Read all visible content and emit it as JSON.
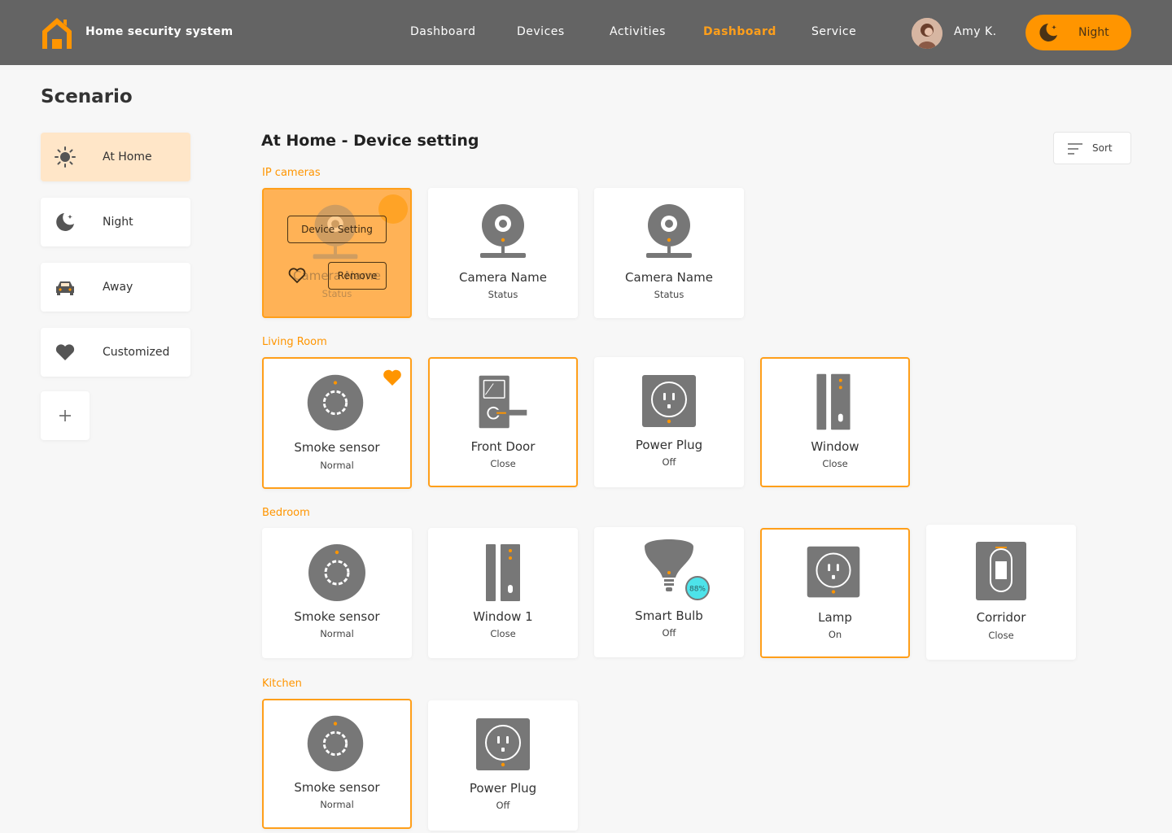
{
  "header": {
    "app_title": "Home security system",
    "nav": [
      {
        "label": "Dashboard"
      },
      {
        "label": "Devices"
      },
      {
        "label": "Activities"
      },
      {
        "label": "Dashboard",
        "active": true
      },
      {
        "label": "Service"
      }
    ],
    "user_name": "Amy K.",
    "mode_button": "Night"
  },
  "sidebar": {
    "title": "Scenario",
    "items": [
      {
        "label": "At Home",
        "icon": "sun-icon",
        "active": true
      },
      {
        "label": "Night",
        "icon": "moon-icon"
      },
      {
        "label": "Away",
        "icon": "car-icon"
      },
      {
        "label": "Customized",
        "icon": "heart-icon"
      }
    ],
    "add_icon": "plus-icon"
  },
  "main": {
    "title": "At Home - Device setting",
    "sort_label": "Sort",
    "overlay": {
      "device_setting": "Device Setting",
      "remove": "Remove",
      "ghost_name": "Camera Name",
      "ghost_status": "Status"
    },
    "sections": [
      {
        "label": "IP cameras",
        "devices": [
          {
            "name": "Camera Name",
            "status": "Status",
            "icon": "camera-icon"
          },
          {
            "name": "Camera Name",
            "status": "Status",
            "icon": "camera-icon"
          }
        ]
      },
      {
        "label": "Living Room",
        "devices": [
          {
            "name": "Smoke sensor",
            "status": "Normal",
            "icon": "smoke-sensor-icon",
            "favorite": true
          },
          {
            "name": "Front Door",
            "status": "Close",
            "icon": "door-lock-icon"
          },
          {
            "name": "Power Plug",
            "status": "Off",
            "icon": "power-plug-icon"
          },
          {
            "name": "Window",
            "status": "Close",
            "icon": "window-sensor-icon"
          }
        ]
      },
      {
        "label": "Bedroom",
        "devices": [
          {
            "name": "Smoke sensor",
            "status": "Normal",
            "icon": "smoke-sensor-icon"
          },
          {
            "name": "Window 1",
            "status": "Close",
            "icon": "window-sensor-icon"
          },
          {
            "name": "Smart Bulb",
            "status": "Off",
            "icon": "bulb-icon",
            "badge": "88%"
          },
          {
            "name": "Lamp",
            "status": "On",
            "icon": "power-plug-icon"
          },
          {
            "name": "Corridor",
            "status": "Close",
            "icon": "motion-sensor-icon"
          }
        ]
      },
      {
        "label": "Kitchen",
        "devices": [
          {
            "name": "Smoke sensor",
            "status": "Normal",
            "icon": "smoke-sensor-icon"
          },
          {
            "name": "Power Plug",
            "status": "Off",
            "icon": "power-plug-icon"
          }
        ]
      }
    ]
  },
  "colors": {
    "accent": "#ff9500",
    "header_bg": "#646464",
    "icon_gray": "#7a7a7a",
    "active_scenario_bg": "#ffe6c8",
    "bulb_badge": "#4de3ea"
  }
}
